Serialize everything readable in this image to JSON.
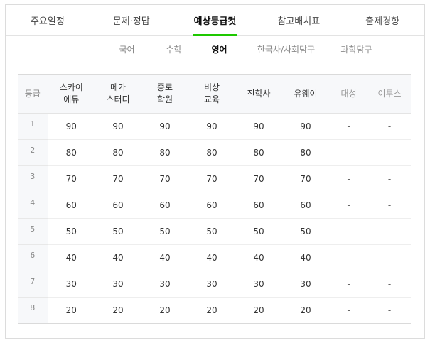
{
  "main_tabs": [
    {
      "label": "주요일정",
      "active": false
    },
    {
      "label": "문제·정답",
      "active": false
    },
    {
      "label": "예상등급컷",
      "active": true
    },
    {
      "label": "참고배치표",
      "active": false
    },
    {
      "label": "출제경향",
      "active": false
    }
  ],
  "sub_tabs": [
    {
      "label": "국어",
      "active": false
    },
    {
      "label": "수학",
      "active": false
    },
    {
      "label": "영어",
      "active": true
    },
    {
      "label": "한국사/사회탐구",
      "active": false
    },
    {
      "label": "과학탐구",
      "active": false
    }
  ],
  "table": {
    "header": {
      "grade": "등급",
      "columns": [
        {
          "line1": "스카이",
          "line2": "에듀"
        },
        {
          "line1": "메가",
          "line2": "스터디"
        },
        {
          "line1": "종로",
          "line2": "학원"
        },
        {
          "line1": "비상",
          "line2": "교육"
        },
        {
          "line1": "진학사",
          "line2": ""
        },
        {
          "line1": "유웨이",
          "line2": ""
        },
        {
          "line1": "대성",
          "line2": ""
        },
        {
          "line1": "이투스",
          "line2": ""
        }
      ]
    },
    "rows": [
      {
        "grade": "1",
        "values": [
          "90",
          "90",
          "90",
          "90",
          "90",
          "90",
          "-",
          "-"
        ]
      },
      {
        "grade": "2",
        "values": [
          "80",
          "80",
          "80",
          "80",
          "80",
          "80",
          "-",
          "-"
        ]
      },
      {
        "grade": "3",
        "values": [
          "70",
          "70",
          "70",
          "70",
          "70",
          "70",
          "-",
          "-"
        ]
      },
      {
        "grade": "4",
        "values": [
          "60",
          "60",
          "60",
          "60",
          "60",
          "60",
          "-",
          "-"
        ]
      },
      {
        "grade": "5",
        "values": [
          "50",
          "50",
          "50",
          "50",
          "50",
          "50",
          "-",
          "-"
        ]
      },
      {
        "grade": "6",
        "values": [
          "40",
          "40",
          "40",
          "40",
          "40",
          "40",
          "-",
          "-"
        ]
      },
      {
        "grade": "7",
        "values": [
          "30",
          "30",
          "30",
          "30",
          "30",
          "30",
          "-",
          "-"
        ]
      },
      {
        "grade": "8",
        "values": [
          "20",
          "20",
          "20",
          "20",
          "20",
          "20",
          "-",
          "-"
        ]
      }
    ]
  },
  "colors": {
    "accent": "#1ec800",
    "header_bg": "#f7f8fa"
  }
}
